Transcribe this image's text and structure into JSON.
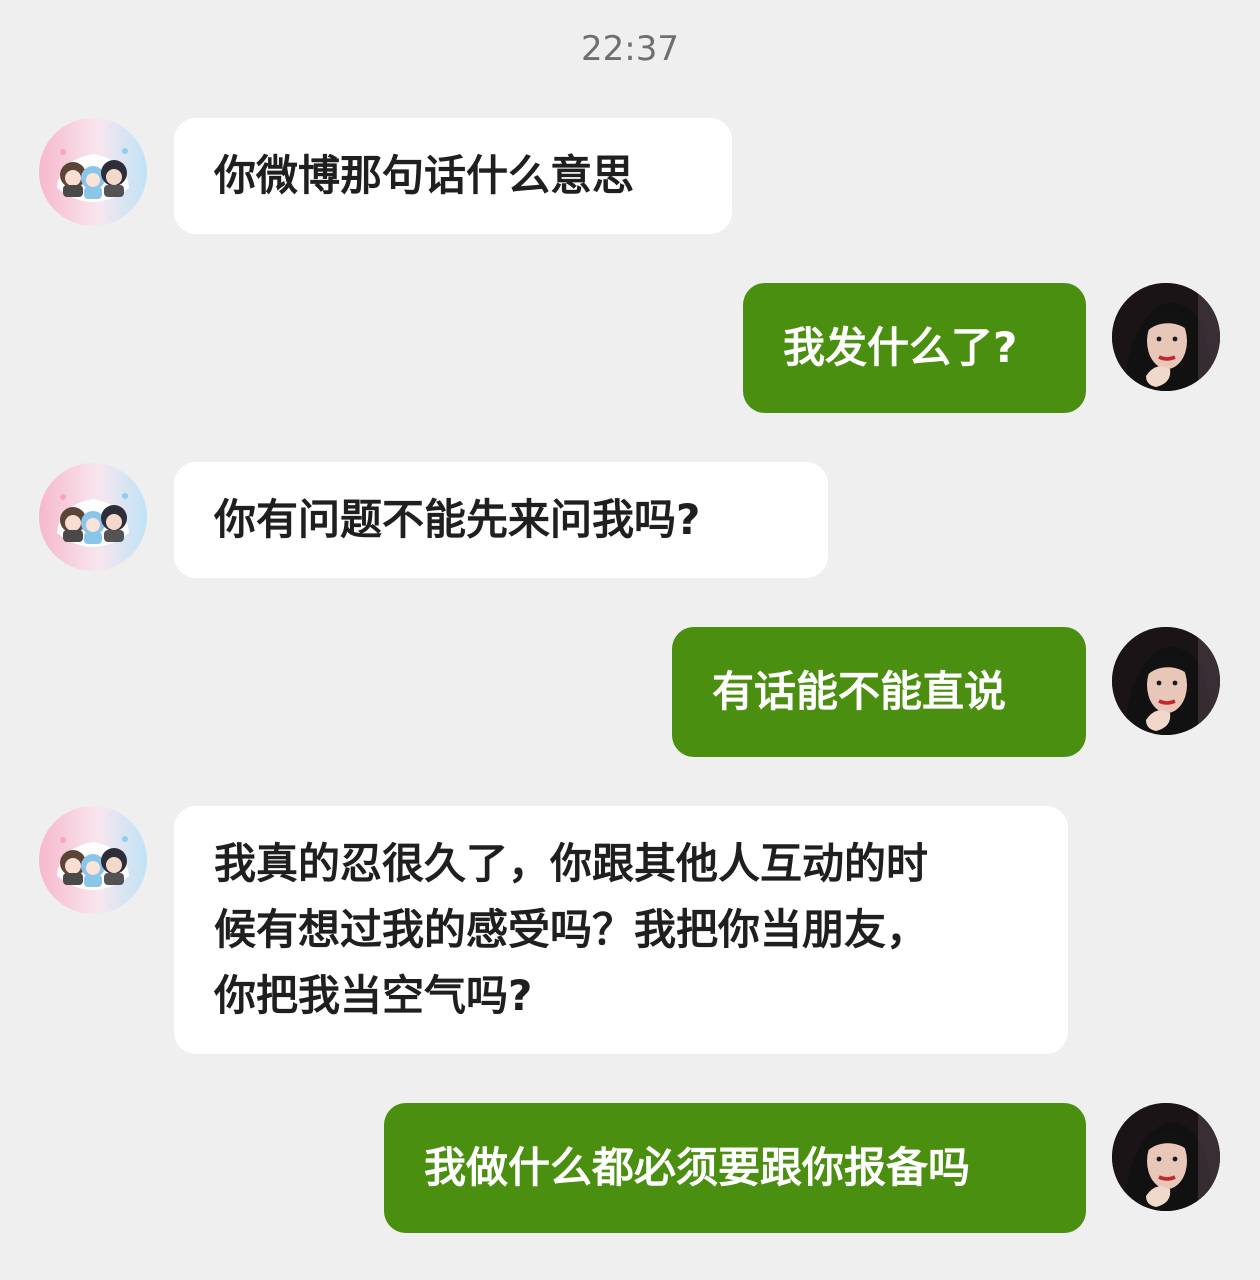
{
  "timestamp": "22:37",
  "messages": [
    {
      "sender": "other",
      "avatar": "cartoon-friend-avatar",
      "text": "你微博那句话什么意思"
    },
    {
      "sender": "self",
      "avatar": "user-portrait-avatar",
      "text": "我发什么了?"
    },
    {
      "sender": "other",
      "avatar": "cartoon-friend-avatar",
      "text": "你有问题不能先来问我吗?"
    },
    {
      "sender": "self",
      "avatar": "user-portrait-avatar",
      "text": "有话能不能直说"
    },
    {
      "sender": "other",
      "avatar": "cartoon-friend-avatar",
      "lines": [
        "我真的忍很久了，你跟其他人互动的时",
        "候有想过我的感受吗？我把你当朋友，",
        "你把我当空气吗?"
      ]
    },
    {
      "sender": "self",
      "avatar": "user-portrait-avatar",
      "text": "我做什么都必须要跟你报备吗"
    }
  ],
  "colors": {
    "background": "#efefef",
    "incoming_bubble": "#ffffff",
    "outgoing_bubble": "#4a8f0f",
    "timestamp_text": "#6f6f6f"
  }
}
